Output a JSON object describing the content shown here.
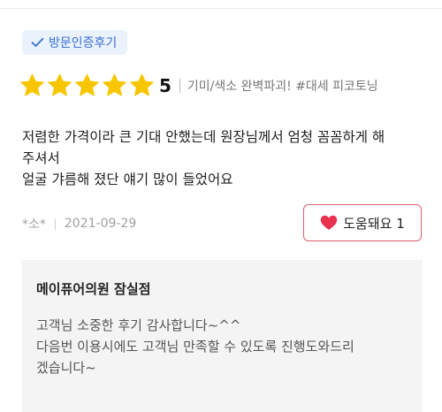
{
  "badge": {
    "label": "방문인증후기",
    "icon": "check-icon",
    "color": "#3a6fd4",
    "background": "#eaf2fd"
  },
  "rating": {
    "score": "5",
    "stars": 5,
    "max_stars": 5,
    "star_color": "#f7c600",
    "star_icon": "star-icon"
  },
  "treatment": "기미/색소 완벽파괴! #대세 피코토닝",
  "review": {
    "lines": [
      "저렴한 가격이라 큰 기대 안했는데 원장님께서 엄청 꼼꼼하게 해",
      "주셔서",
      "얼굴 갸름해 졌단 얘기 많이 들었어요"
    ]
  },
  "meta": {
    "author": "*소*",
    "date": "2021-09-29"
  },
  "helpful_button": {
    "label": "도움돼요 1",
    "icon": "heart-icon",
    "heart_color": "#e8314f",
    "border_color": "#d4606f"
  },
  "reply": {
    "title": "메이퓨어의원 잠실점",
    "lines": [
      "고객님 소중한 후기 감사합니다~^^",
      "다음번 이용시에도 고객님 만족할 수 있도록 진행도와드리",
      "겠습니다~"
    ]
  }
}
